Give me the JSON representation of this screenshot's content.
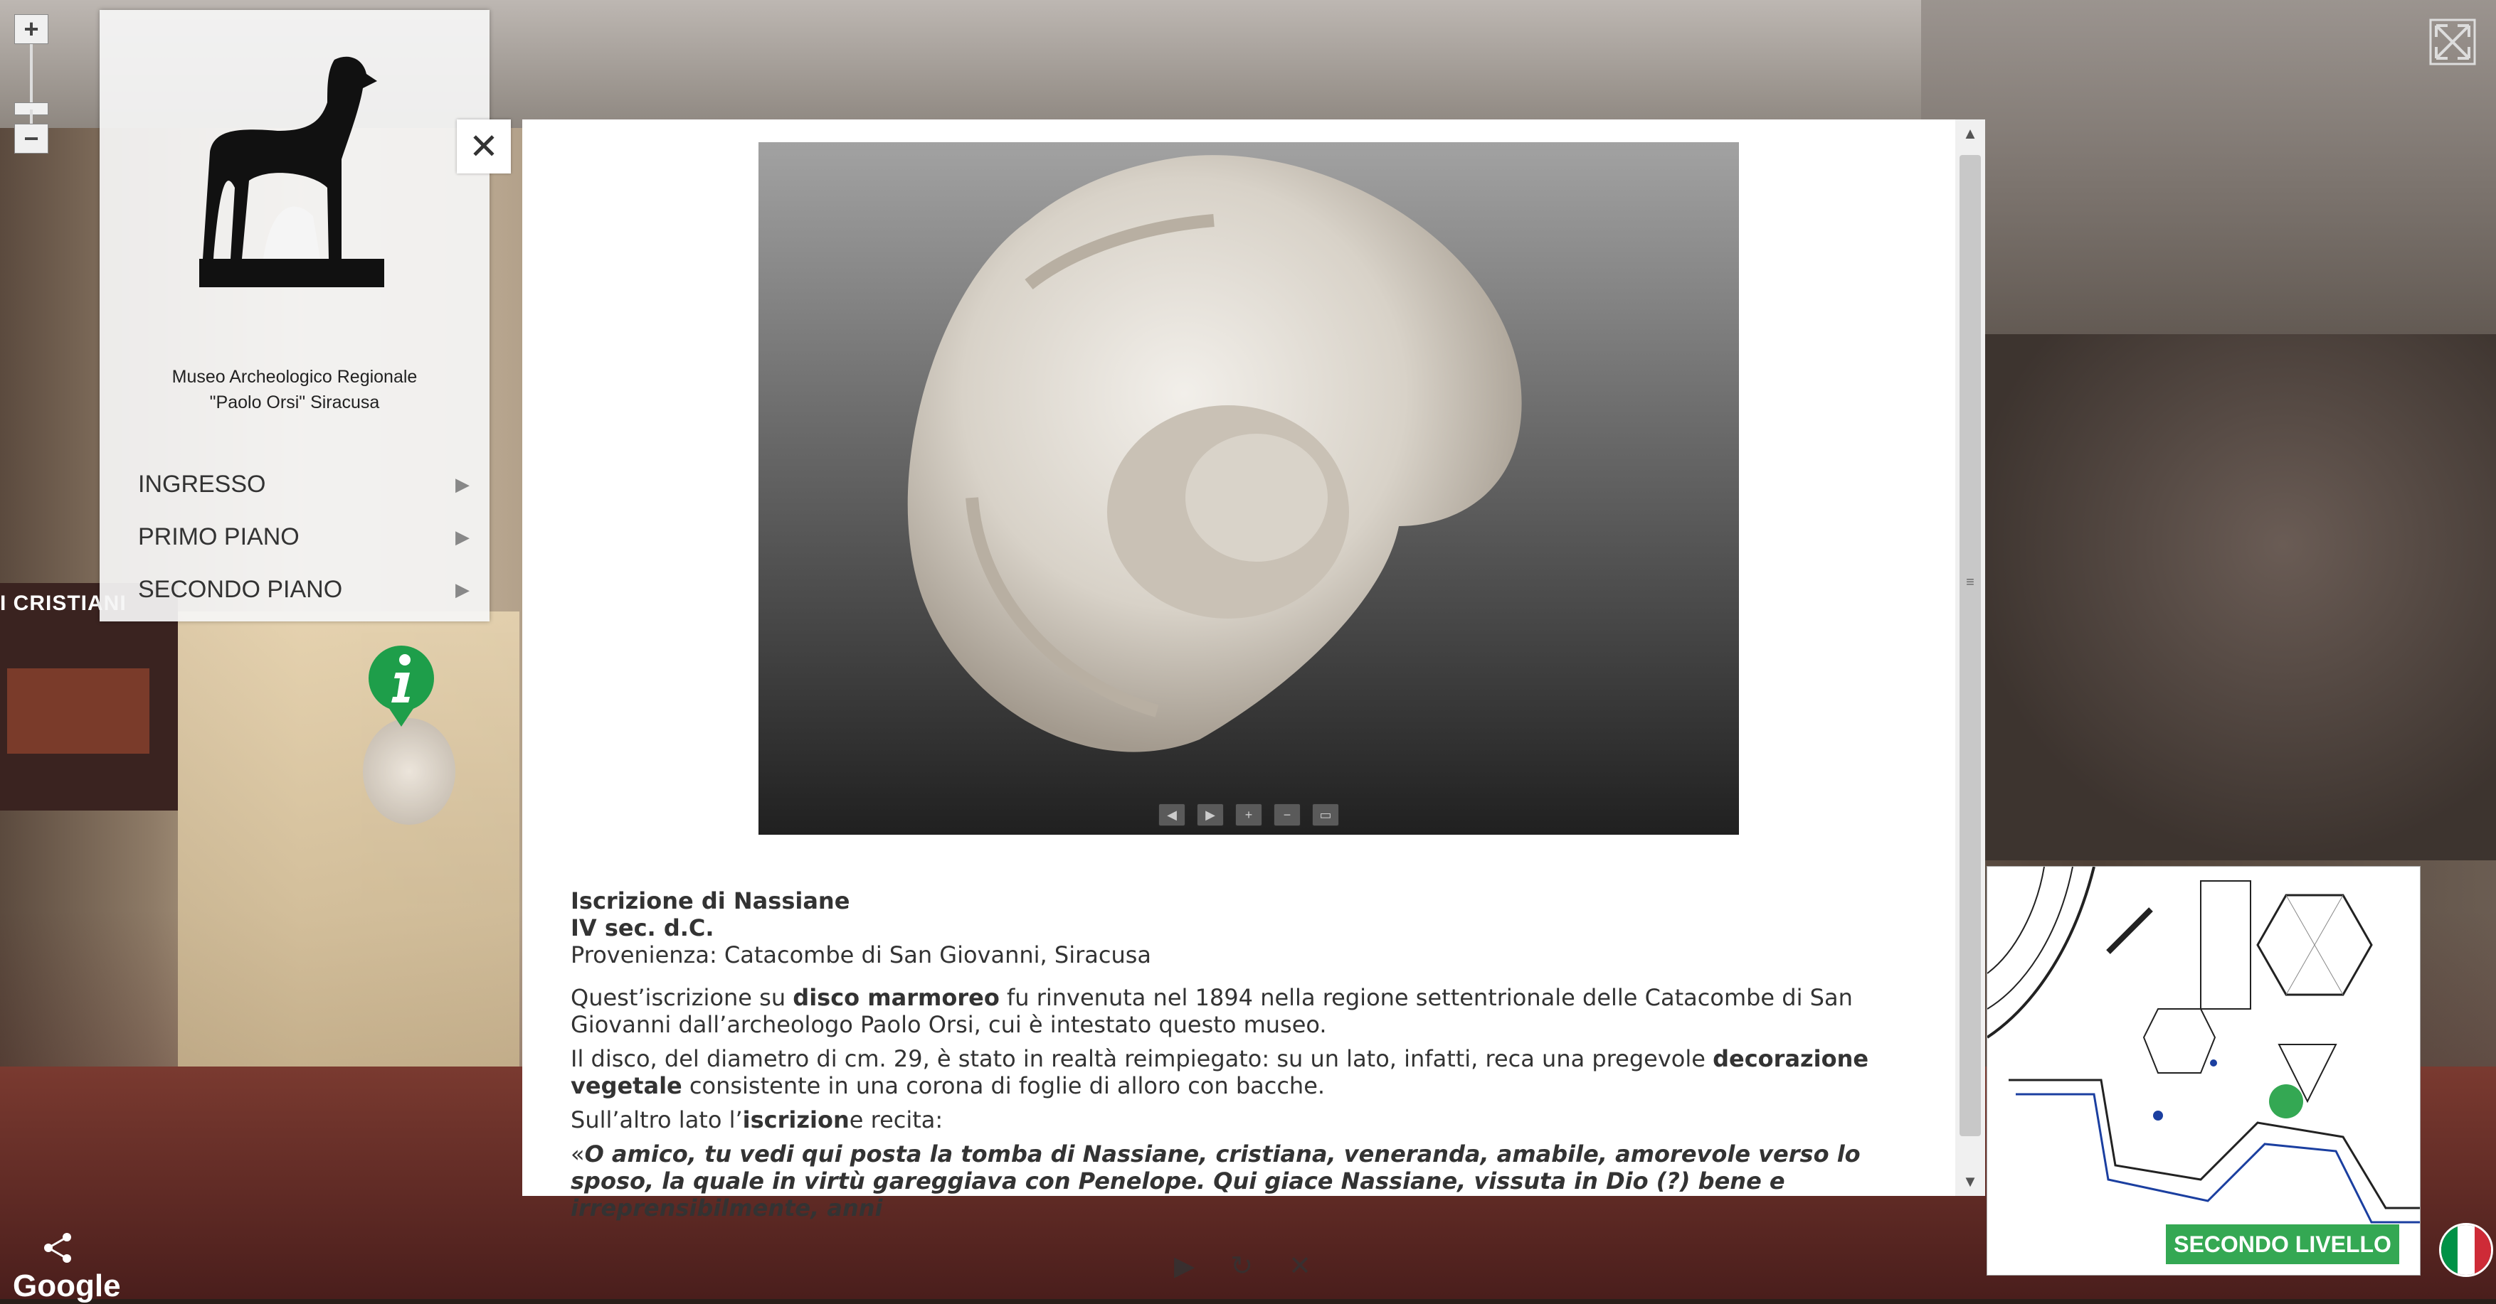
{
  "zoom": {
    "in": "+",
    "out": "−"
  },
  "sidebar": {
    "museum_name_line1": "Museo Archeologico Regionale",
    "museum_name_line2": "\"Paolo Orsi\" Siracusa",
    "items": [
      {
        "label": "INGRESSO"
      },
      {
        "label": "PRIMO PIANO"
      },
      {
        "label": "SECONDO PIANO"
      }
    ]
  },
  "close": {
    "label": "✕"
  },
  "background": {
    "poster_title": "I CRISTIANI"
  },
  "modal": {
    "title": "Iscrizione di Nassiane",
    "date": "IV sec. d.C.",
    "provenance": "Provenienza: Catacombe di San Giovanni, Siracusa",
    "p1_a": "Quest’iscrizione su ",
    "p1_b": "disco marmoreo",
    "p1_c": " fu rinvenuta nel 1894 nella regione settentrionale delle Catacombe di San Giovanni dall’archeologo Paolo Orsi, cui è intestato questo museo.",
    "p2_a": "Il disco, del diametro di cm. 29, è stato in realtà reimpiegato: su un lato, infatti, reca una pregevole ",
    "p2_b": "decorazione vegetale",
    "p2_c": " consistente in una corona di foglie di alloro con bacche.",
    "p3_a": "Sull’altro lato l’",
    "p3_b": "iscrizion",
    "p3_c": "e recita:",
    "quote_open": "«",
    "quote": "O amico, tu vedi qui posta la tomba di Nassiane, cristiana, veneranda, amabile, amorevole verso lo sposo, la quale in virtù gareggiava con Penelope. Qui giace Nassiane, vissuta in Dio (?) bene e irreprensibilmente, anni"
  },
  "viewer": {
    "controls": [
      "◀",
      "▶",
      "+",
      "−",
      "▭"
    ]
  },
  "map": {
    "label": "SECONDO LIVELLO"
  },
  "footer": {
    "brand": "Google",
    "share_icon": "share-icon",
    "play": "▶",
    "rotate": "↻",
    "close": "✕"
  },
  "colors": {
    "pin_green": "#1e9e4a",
    "map_label_green": "#34a853",
    "flag_green": "#009246",
    "flag_white": "#ffffff",
    "flag_red": "#ce2b37"
  }
}
